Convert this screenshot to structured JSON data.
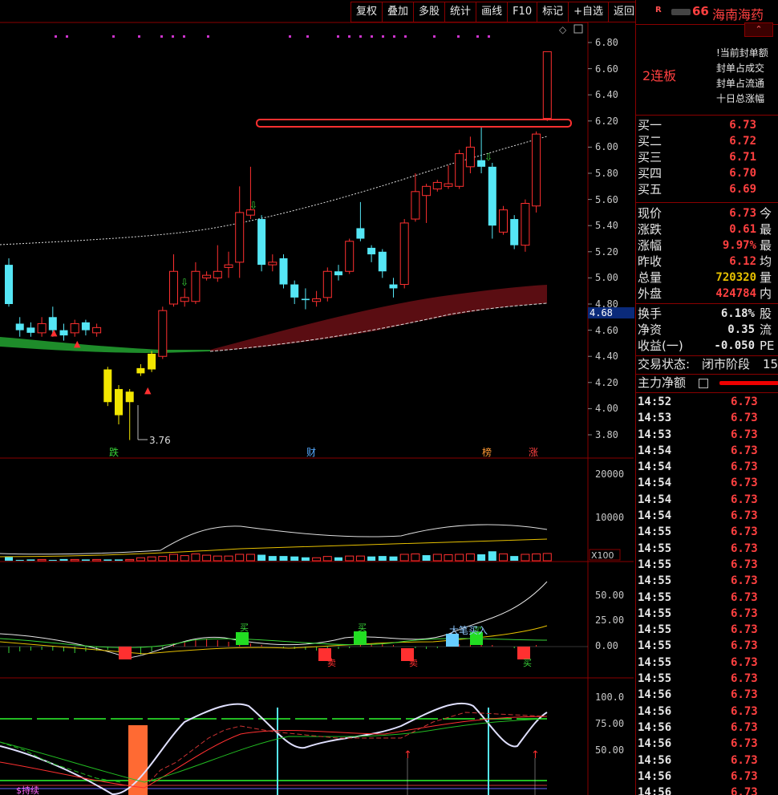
{
  "toolbar": [
    "复权",
    "叠加",
    "多股",
    "统计",
    "画线",
    "F10",
    "标记",
    "+自选",
    "返回"
  ],
  "stock": {
    "badge": "R",
    "code_suffix": "66",
    "name": "海南海药",
    "board": "2连板"
  },
  "info_lines": [
    "!当前封单额",
    "封单占成交",
    "封单占流通",
    "十日总涨幅"
  ],
  "bids": [
    {
      "label": "买一",
      "value": "6.73"
    },
    {
      "label": "买二",
      "value": "6.72"
    },
    {
      "label": "买三",
      "value": "6.71"
    },
    {
      "label": "买四",
      "value": "6.70"
    },
    {
      "label": "买五",
      "value": "6.69"
    }
  ],
  "quote": [
    {
      "label": "现价",
      "value": "6.73",
      "ext": "今"
    },
    {
      "label": "涨跌",
      "value": "0.61",
      "ext": "最"
    },
    {
      "label": "涨幅",
      "value": "9.97%",
      "ext": "最"
    },
    {
      "label": "昨收",
      "value": "6.12",
      "ext": "均"
    },
    {
      "label": "总量",
      "value": "720320",
      "ext": "量"
    },
    {
      "label": "外盘",
      "value": "424784",
      "ext": "内"
    }
  ],
  "fund": [
    {
      "label": "换手",
      "value": "6.18%",
      "ext": "股"
    },
    {
      "label": "净资",
      "value": "0.35",
      "ext": "流"
    },
    {
      "label": "收益(一)",
      "value": "-0.050",
      "ext": "PE"
    }
  ],
  "status": {
    "label": "交易状态:",
    "value": "闭市阶段",
    "num": "15"
  },
  "net_flow": {
    "label": "主力净额"
  },
  "ticks": [
    {
      "time": "14:52",
      "price": "6.73"
    },
    {
      "time": "14:53",
      "price": "6.73"
    },
    {
      "time": "14:53",
      "price": "6.73"
    },
    {
      "time": "14:54",
      "price": "6.73"
    },
    {
      "time": "14:54",
      "price": "6.73"
    },
    {
      "time": "14:54",
      "price": "6.73"
    },
    {
      "time": "14:54",
      "price": "6.73"
    },
    {
      "time": "14:54",
      "price": "6.73"
    },
    {
      "time": "14:55",
      "price": "6.73"
    },
    {
      "time": "14:55",
      "price": "6.73"
    },
    {
      "time": "14:55",
      "price": "6.73"
    },
    {
      "time": "14:55",
      "price": "6.73"
    },
    {
      "time": "14:55",
      "price": "6.73"
    },
    {
      "time": "14:55",
      "price": "6.73"
    },
    {
      "time": "14:55",
      "price": "6.73"
    },
    {
      "time": "14:55",
      "price": "6.73"
    },
    {
      "time": "14:55",
      "price": "6.73"
    },
    {
      "time": "14:55",
      "price": "6.73"
    },
    {
      "time": "14:56",
      "price": "6.73"
    },
    {
      "time": "14:56",
      "price": "6.73"
    },
    {
      "time": "14:56",
      "price": "6.73"
    },
    {
      "time": "14:56",
      "price": "6.73"
    },
    {
      "time": "14:56",
      "price": "6.73"
    },
    {
      "time": "14:56",
      "price": "6.73"
    },
    {
      "time": "14:56",
      "price": "6.73"
    }
  ],
  "chart_data": {
    "type": "candlestick",
    "price_ticks": [
      "6.80",
      "6.60",
      "6.40",
      "6.20",
      "6.00",
      "5.80",
      "5.60",
      "5.40",
      "5.20",
      "5.00",
      "4.80",
      "4.60",
      "4.40",
      "4.20",
      "4.00",
      "3.80"
    ],
    "current_price_tag": "4.68",
    "low_annotation": "3.76",
    "markers": [
      "跌",
      "财",
      "榜",
      "涨"
    ],
    "volume_ticks": [
      "20000",
      "10000"
    ],
    "volume_unit": "X100",
    "macd_ticks": [
      "50.00",
      "25.00",
      "0.00"
    ],
    "kdj_ticks": [
      "100.0",
      "75.00",
      "50.00"
    ],
    "signals": [
      "卖",
      "卖",
      "买",
      "买",
      "买",
      "大笔买入",
      "买"
    ],
    "bottom_label": "$持续",
    "candles": [
      {
        "o": 5.1,
        "c": 4.8,
        "h": 5.15,
        "l": 4.78
      },
      {
        "o": 4.65,
        "c": 4.6,
        "h": 4.7,
        "l": 4.55
      },
      {
        "o": 4.62,
        "c": 4.58,
        "h": 4.66,
        "l": 4.55
      },
      {
        "o": 4.58,
        "c": 4.65,
        "h": 4.7,
        "l": 4.55
      },
      {
        "o": 4.7,
        "c": 4.6,
        "h": 4.78,
        "l": 4.55
      },
      {
        "o": 4.6,
        "c": 4.56,
        "h": 4.65,
        "l": 4.52
      },
      {
        "o": 4.58,
        "c": 4.65,
        "h": 4.68,
        "l": 4.55
      },
      {
        "o": 4.66,
        "c": 4.6,
        "h": 4.68,
        "l": 4.56
      },
      {
        "o": 4.58,
        "c": 4.62,
        "h": 4.65,
        "l": 4.55
      },
      {
        "o": 4.3,
        "c": 4.05,
        "h": 4.32,
        "l": 4.02
      },
      {
        "o": 4.15,
        "c": 3.95,
        "h": 4.18,
        "l": 3.88
      },
      {
        "o": 4.05,
        "c": 4.13,
        "h": 4.15,
        "l": 3.76
      },
      {
        "o": 4.27,
        "c": 4.31,
        "h": 4.34,
        "l": 4.25
      },
      {
        "o": 4.3,
        "c": 4.42,
        "h": 4.44,
        "l": 4.28
      },
      {
        "o": 4.4,
        "c": 4.75,
        "h": 4.78,
        "l": 4.38
      },
      {
        "o": 4.8,
        "c": 5.05,
        "h": 5.18,
        "l": 4.78
      },
      {
        "o": 4.82,
        "c": 4.85,
        "h": 4.92,
        "l": 4.78
      },
      {
        "o": 4.82,
        "c": 5.05,
        "h": 5.12,
        "l": 4.8
      },
      {
        "o": 5.0,
        "c": 5.02,
        "h": 5.05,
        "l": 4.98
      },
      {
        "o": 5.0,
        "c": 5.05,
        "h": 5.25,
        "l": 4.97
      },
      {
        "o": 5.08,
        "c": 5.1,
        "h": 5.2,
        "l": 5.0
      },
      {
        "o": 5.12,
        "c": 5.5,
        "h": 5.7,
        "l": 5.0
      },
      {
        "o": 5.48,
        "c": 5.52,
        "h": 5.85,
        "l": 5.45
      },
      {
        "o": 5.45,
        "c": 5.1,
        "h": 5.48,
        "l": 5.05
      },
      {
        "o": 5.1,
        "c": 5.12,
        "h": 5.18,
        "l": 5.05
      },
      {
        "o": 5.15,
        "c": 4.95,
        "h": 5.18,
        "l": 4.92
      },
      {
        "o": 4.95,
        "c": 4.85,
        "h": 4.98,
        "l": 4.8
      },
      {
        "o": 4.84,
        "c": 4.83,
        "h": 4.92,
        "l": 4.76
      },
      {
        "o": 4.82,
        "c": 4.84,
        "h": 4.9,
        "l": 4.78
      },
      {
        "o": 4.85,
        "c": 5.05,
        "h": 5.08,
        "l": 4.82
      },
      {
        "o": 5.05,
        "c": 5.02,
        "h": 5.1,
        "l": 4.98
      },
      {
        "o": 5.05,
        "c": 5.28,
        "h": 5.3,
        "l": 5.03
      },
      {
        "o": 5.38,
        "c": 5.3,
        "h": 5.58,
        "l": 5.28
      },
      {
        "o": 5.23,
        "c": 5.18,
        "h": 5.25,
        "l": 5.12
      },
      {
        "o": 5.2,
        "c": 5.05,
        "h": 5.22,
        "l": 5.0
      },
      {
        "o": 4.95,
        "c": 4.92,
        "h": 5.0,
        "l": 4.85
      },
      {
        "o": 4.95,
        "c": 5.42,
        "h": 5.45,
        "l": 4.92
      },
      {
        "o": 5.45,
        "c": 5.66,
        "h": 5.8,
        "l": 5.43
      },
      {
        "o": 5.63,
        "c": 5.7,
        "h": 5.72,
        "l": 5.42
      },
      {
        "o": 5.68,
        "c": 5.73,
        "h": 5.75,
        "l": 5.66
      },
      {
        "o": 5.7,
        "c": 5.72,
        "h": 5.86,
        "l": 5.68
      },
      {
        "o": 5.7,
        "c": 5.95,
        "h": 5.98,
        "l": 5.68
      },
      {
        "o": 5.85,
        "c": 6.0,
        "h": 6.08,
        "l": 5.8
      },
      {
        "o": 5.9,
        "c": 5.85,
        "h": 6.15,
        "l": 5.8
      },
      {
        "o": 5.85,
        "c": 5.4,
        "h": 5.88,
        "l": 5.3
      },
      {
        "o": 5.35,
        "c": 5.52,
        "h": 5.55,
        "l": 5.33
      },
      {
        "o": 5.45,
        "c": 5.25,
        "h": 5.48,
        "l": 5.22
      },
      {
        "o": 5.25,
        "c": 5.57,
        "h": 5.6,
        "l": 5.2
      },
      {
        "o": 5.55,
        "c": 6.1,
        "h": 6.12,
        "l": 5.5
      },
      {
        "o": 6.22,
        "c": 6.73,
        "h": 6.73,
        "l": 6.2
      }
    ],
    "volume": [
      900,
      200,
      300,
      300,
      200,
      400,
      300,
      300,
      300,
      300,
      300,
      300,
      700,
      900,
      1000,
      1500,
      1200,
      1600,
      1300,
      1100,
      1100,
      1500,
      1500,
      1400,
      1100,
      1100,
      1000,
      800,
      700,
      1000,
      800,
      1100,
      1100,
      1000,
      1100,
      1000,
      1500,
      1600,
      1300,
      1500,
      1400,
      1500,
      1600,
      1500,
      2200,
      1600,
      1100,
      1500,
      1600,
      1700
    ],
    "volume_up": [
      false,
      false,
      false,
      true,
      false,
      false,
      true,
      false,
      true,
      false,
      false,
      true,
      true,
      true,
      true,
      true,
      true,
      true,
      true,
      true,
      true,
      true,
      true,
      false,
      false,
      false,
      false,
      false,
      true,
      true,
      false,
      true,
      true,
      false,
      false,
      false,
      true,
      true,
      false,
      true,
      true,
      true,
      true,
      false,
      false,
      true,
      false,
      true,
      true,
      true
    ]
  }
}
